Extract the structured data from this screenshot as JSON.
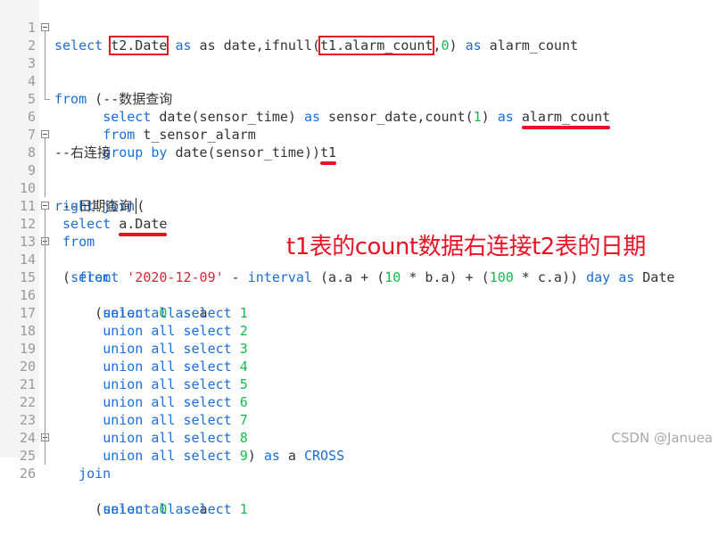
{
  "editor": {
    "lines": [
      {
        "n": "1"
      },
      {
        "n": "2"
      },
      {
        "n": "3"
      },
      {
        "n": "4"
      },
      {
        "n": "5"
      },
      {
        "n": "6"
      },
      {
        "n": "7"
      },
      {
        "n": "8"
      },
      {
        "n": "9"
      },
      {
        "n": "10"
      },
      {
        "n": "11"
      },
      {
        "n": "12"
      },
      {
        "n": "13"
      },
      {
        "n": "14"
      },
      {
        "n": "15"
      },
      {
        "n": "16"
      },
      {
        "n": "17"
      },
      {
        "n": "18"
      },
      {
        "n": "19"
      },
      {
        "n": "20"
      },
      {
        "n": "21"
      },
      {
        "n": "22"
      },
      {
        "n": "23"
      },
      {
        "n": "24"
      },
      {
        "n": "25"
      },
      {
        "n": "26"
      }
    ],
    "tokens": {
      "select": "select",
      "from": "from",
      "as": "as",
      "group_by": "group by",
      "right_join": "right join",
      "interval": "interval",
      "day": "day",
      "union_all_select": "union all select",
      "cross": "CROSS",
      "join": "join",
      "l1_t2date": "t2.Date",
      "l1_mid": " as date,ifnull(",
      "l1_t1count": "t1.alarm_count",
      "l1_comma": ",",
      "l1_zero": "0",
      "l1_close": ") ",
      "l1_alias": " alarm_count",
      "l2_paren": " (",
      "l3_comment": "--数据查询",
      "l4_func": " date(sensor_time) ",
      "l4_mid": " sensor_date,count(",
      "l4_one": "1",
      "l4_close": ") ",
      "l4_alias": "alarm_count",
      "l5_table": " t_sensor_alarm",
      "l6_func": " date(sensor_time))",
      "l6_alias": "t1",
      "l7_comment": "--右连接",
      "l8_paren": "(",
      "l9_comment": "--日期查询",
      "l10_field": "a.Date",
      "l12_open": "(",
      "l12_str": "'2020-12-09'",
      "l12_minus": " - ",
      "l12_expr1": " (a.a + (",
      "l12_ten": "10",
      "l12_expr2": " * b.a) + (",
      "l12_hundred": "100",
      "l12_expr3": " * c.a)) ",
      "l12_alias": " Date",
      "sub_open": "(",
      "zero": "0",
      "alias_a": " a",
      "nums": [
        "1",
        "2",
        "3",
        "4",
        "5",
        "6",
        "7",
        "8",
        "9"
      ],
      "l23_close": ") ",
      "l23_a": " a "
    }
  },
  "annotation": {
    "text": "t1表的count数据右连接t2表的日期"
  },
  "watermark": {
    "text": "CSDN @Januea"
  },
  "colors": {
    "keyword": "#1a6fd8",
    "number": "#19b94d",
    "string": "#e0223a",
    "highlight": "#e81224",
    "gutter_bg": "#f4f4f4"
  }
}
